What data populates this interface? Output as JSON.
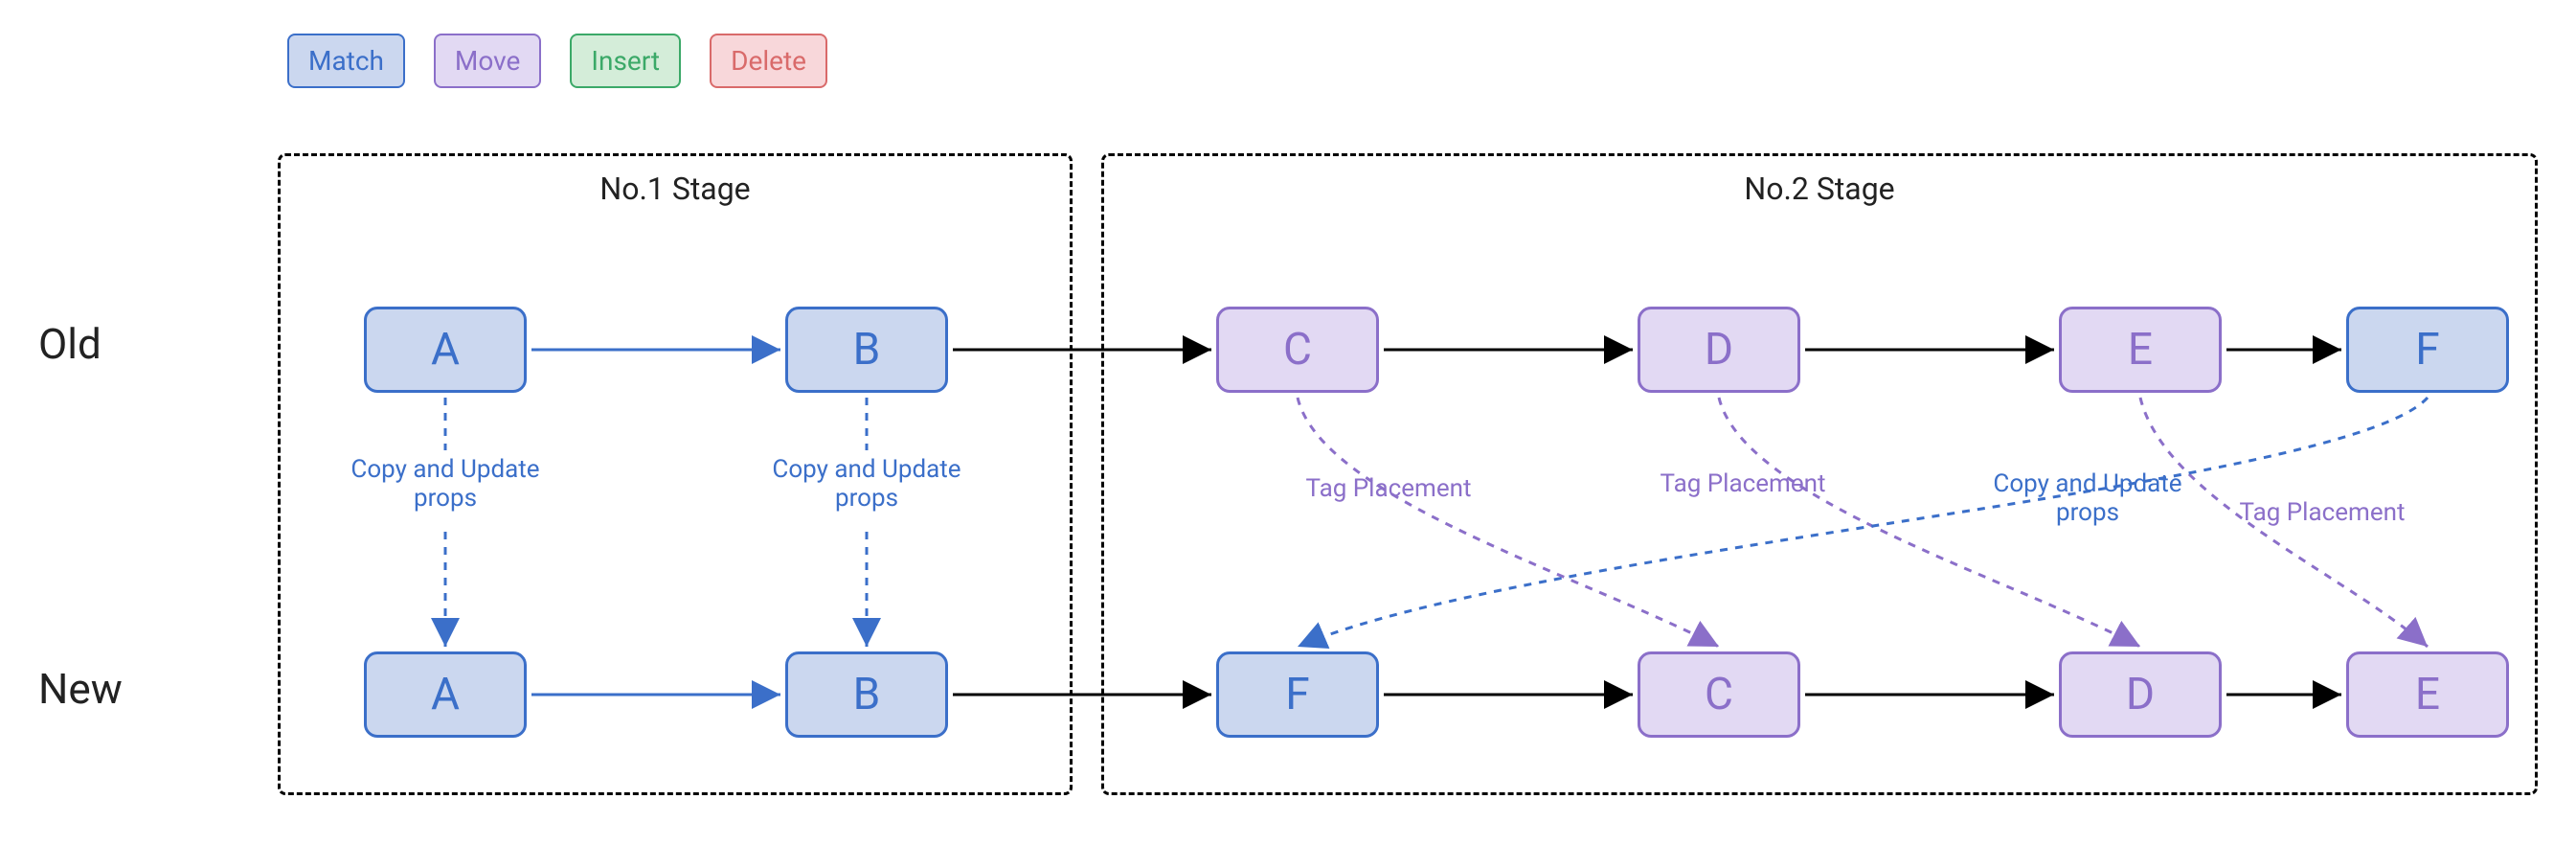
{
  "legend": {
    "match": "Match",
    "move": "Move",
    "insert": "Insert",
    "delete": "Delete"
  },
  "row_labels": {
    "old": "Old",
    "new": "New"
  },
  "stages": {
    "s1": "No.1 Stage",
    "s2": "No.2 Stage"
  },
  "nodes": {
    "old_A": "A",
    "old_B": "B",
    "old_C": "C",
    "old_D": "D",
    "old_E": "E",
    "old_F": "F",
    "new_A": "A",
    "new_B": "B",
    "new_F": "F",
    "new_C": "C",
    "new_D": "D",
    "new_E": "E"
  },
  "annotations": {
    "copy_update_1": "Copy and Update props",
    "copy_update_2": "Copy and Update props",
    "tag_C": "Tag Placement",
    "tag_D": "Tag Placement",
    "copy_update_F": "Copy and Update props",
    "tag_E": "Tag Placement"
  },
  "chart_data": {
    "type": "diagram",
    "description": "Reconciliation diff algorithm showing two stages of list diffing between Old and New sequences",
    "legend": [
      {
        "label": "Match",
        "color": "#3b6fc9",
        "fill": "#cbd7ef"
      },
      {
        "label": "Move",
        "color": "#8b6fc9",
        "fill": "#e2d9f3"
      },
      {
        "label": "Insert",
        "color": "#3ba968",
        "fill": "#d4edd9"
      },
      {
        "label": "Delete",
        "color": "#d96a6a",
        "fill": "#f8d7da"
      }
    ],
    "old_sequence": [
      "A",
      "B",
      "C",
      "D",
      "E",
      "F"
    ],
    "new_sequence": [
      "A",
      "B",
      "F",
      "C",
      "D",
      "E"
    ],
    "stage1": {
      "title": "No.1 Stage",
      "pairs": [
        {
          "old": "A",
          "new": "A",
          "op": "Match",
          "note": "Copy and Update props"
        },
        {
          "old": "B",
          "new": "B",
          "op": "Match",
          "note": "Copy and Update props"
        }
      ]
    },
    "stage2": {
      "title": "No.2 Stage",
      "mappings": [
        {
          "old": "C",
          "new_pos": "C",
          "op": "Move",
          "note": "Tag Placement"
        },
        {
          "old": "D",
          "new_pos": "D",
          "op": "Move",
          "note": "Tag Placement"
        },
        {
          "old": "E",
          "new_pos": "E",
          "op": "Move",
          "note": "Tag Placement"
        },
        {
          "old": "F",
          "new_pos": "F",
          "op": "Match",
          "note": "Copy and Update props"
        }
      ]
    }
  }
}
